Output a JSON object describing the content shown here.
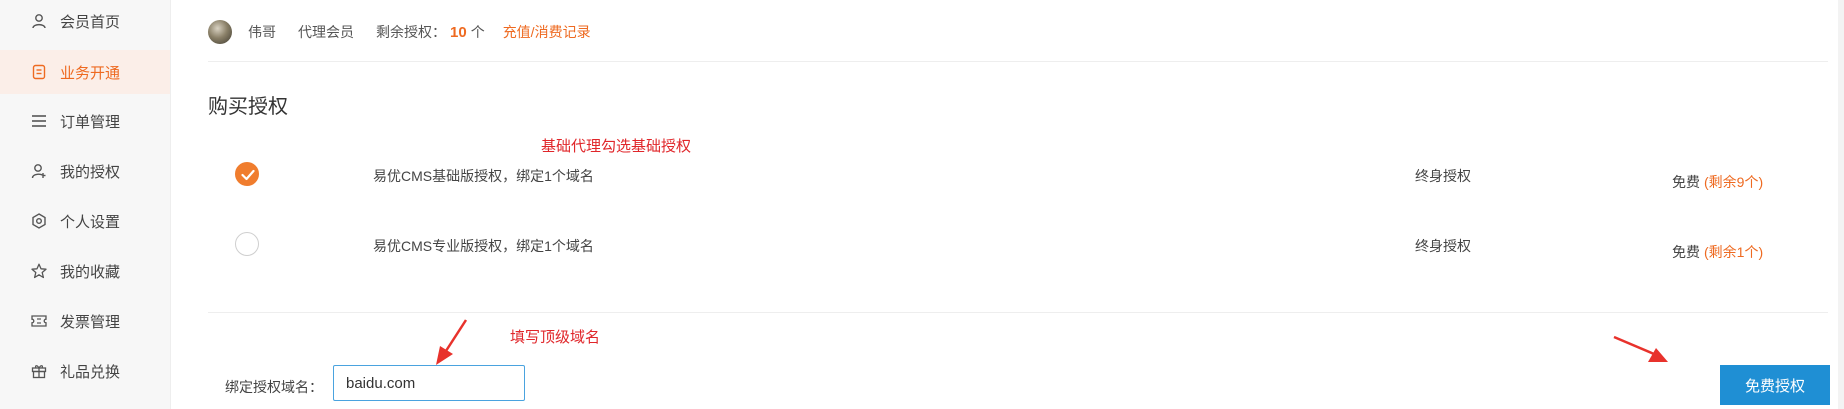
{
  "sidebar": {
    "items": [
      {
        "label": "会员首页",
        "icon": "user-icon",
        "active": false
      },
      {
        "label": "业务开通",
        "icon": "document-icon",
        "active": true
      },
      {
        "label": "订单管理",
        "icon": "list-icon",
        "active": false
      },
      {
        "label": "我的授权",
        "icon": "user-key-icon",
        "active": false
      },
      {
        "label": "个人设置",
        "icon": "settings-icon",
        "active": false
      },
      {
        "label": "我的收藏",
        "icon": "star-icon",
        "active": false
      },
      {
        "label": "发票管理",
        "icon": "ticket-icon",
        "active": false
      },
      {
        "label": "礼品兑换",
        "icon": "gift-icon",
        "active": false
      }
    ]
  },
  "user": {
    "name": "伟哥",
    "level": "代理会员",
    "remaining_label": "剩余授权：",
    "remaining_count": "10",
    "remaining_unit": "个",
    "records_link": "充值/消费记录"
  },
  "purchase": {
    "title": "购买授权",
    "plans": [
      {
        "name": "易优CMS基础版授权，绑定1个域名",
        "term": "终身授权",
        "price": "免费",
        "remaining": "(剩余9个)",
        "checked": true
      },
      {
        "name": "易优CMS专业版授权，绑定1个域名",
        "term": "终身授权",
        "price": "免费",
        "remaining": "(剩余1个)",
        "checked": false
      }
    ]
  },
  "annotations": {
    "basic_hint": "基础代理勾选基础授权",
    "domain_hint": "填写顶级域名"
  },
  "domain": {
    "label": "绑定授权域名：",
    "value": "baidu.com"
  },
  "submit_label": "免费授权",
  "colors": {
    "accent": "#ee6a21",
    "primary_button": "#1f8fd4",
    "annotation": "#e0262a",
    "input_border": "#4aa3df"
  }
}
